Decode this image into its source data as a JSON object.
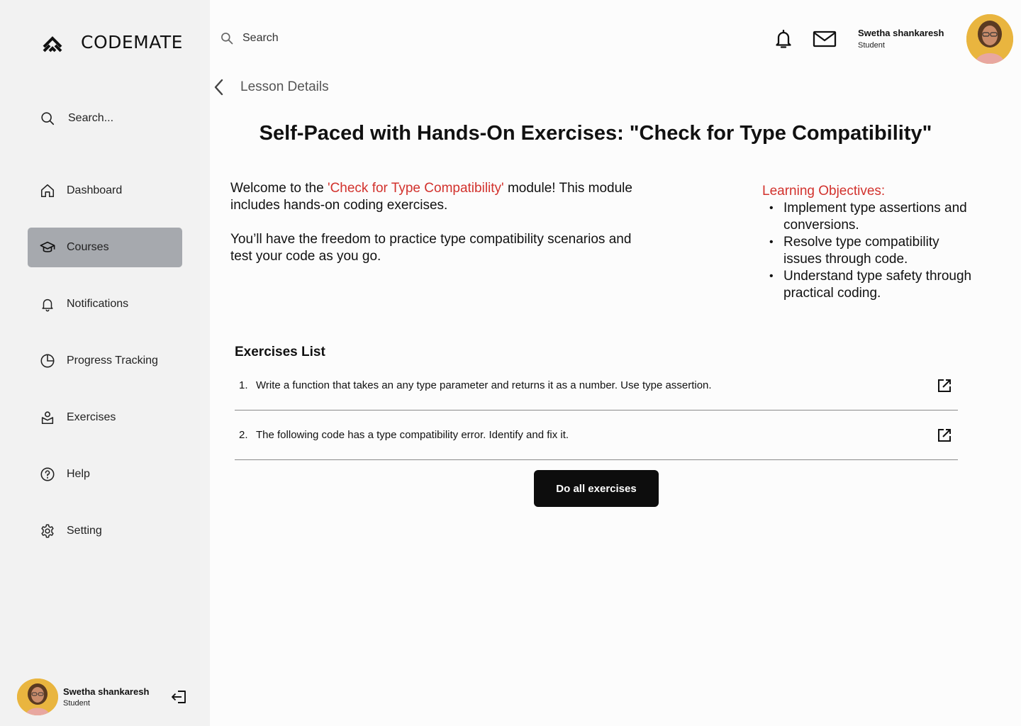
{
  "app": {
    "logo_text": "CODEMATE"
  },
  "sidebar": {
    "search_placeholder": "Search...",
    "items": [
      {
        "label": "Dashboard",
        "icon": "home-icon",
        "active": false
      },
      {
        "label": "Courses",
        "icon": "graduation-cap-icon",
        "active": true
      },
      {
        "label": "Notifications",
        "icon": "bell-icon",
        "active": false
      },
      {
        "label": "Progress Tracking",
        "icon": "pie-chart-icon",
        "active": false
      },
      {
        "label": "Exercises",
        "icon": "exercise-icon",
        "active": false
      },
      {
        "label": "Help",
        "icon": "help-icon",
        "active": false
      },
      {
        "label": "Setting",
        "icon": "gear-icon",
        "active": false
      }
    ],
    "user": {
      "name": "Swetha shankaresh",
      "role": "Student"
    }
  },
  "header": {
    "search_placeholder": "Search",
    "user": {
      "name": "Swetha shankaresh",
      "role": "Student"
    }
  },
  "main": {
    "breadcrumb": "Lesson Details",
    "title": "Self-Paced with Hands-On Exercises: \"Check for Type Compatibility\"",
    "intro": {
      "prefix": "Welcome to the ",
      "highlight": "'Check for Type Compatibility'",
      "suffix": " module! This module includes hands-on coding exercises.",
      "paragraph2": "You’ll have the freedom to practice type compatibility scenarios and test your code as you go."
    },
    "objectives": {
      "title": "Learning Objectives:",
      "items": [
        "Implement type assertions and conversions.",
        "Resolve type compatibility issues through code.",
        "Understand type safety through practical coding."
      ]
    },
    "exercises": {
      "title": "Exercises List",
      "items": [
        {
          "number": "1.",
          "text": "Write a function that takes an any type parameter and returns it as a number. Use type assertion."
        },
        {
          "number": "2.",
          "text": "The following code has a type compatibility error. Identify and fix it."
        }
      ]
    },
    "do_all_label": "Do all exercises"
  },
  "colors": {
    "accent_red": "#d2322d",
    "active_nav": "#a6a9ae",
    "button_bg": "#0d0d0d"
  }
}
